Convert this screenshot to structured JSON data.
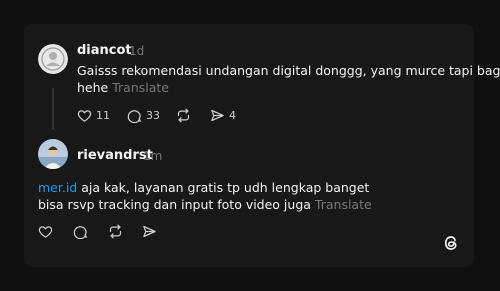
{
  "post1": {
    "username": "diancot",
    "time": "1d",
    "text_line1": "Gaisss rekomendasi undangan digital donggg, yang murce tapi baguss",
    "text_line2": "hehe",
    "translate": "Translate",
    "likes": "11",
    "comments": "33",
    "shares": "4"
  },
  "post2": {
    "username": "rievandrst",
    "time": "1m",
    "mention": "mer.id",
    "text_line1": " aja kak, layanan gratis tp udh lengkap banget",
    "text_line2": "bisa rsvp tracking dan input foto video juga",
    "translate": "Translate"
  },
  "icons": {
    "like": "heart-icon",
    "comment": "comment-icon",
    "repost": "repost-icon",
    "share": "send-icon",
    "logo": "threads-logo-icon"
  },
  "colors": {
    "background": "#101010",
    "card": "#181818",
    "text": "#f3f5f7",
    "muted": "#777777",
    "link": "#1d9bf0"
  }
}
